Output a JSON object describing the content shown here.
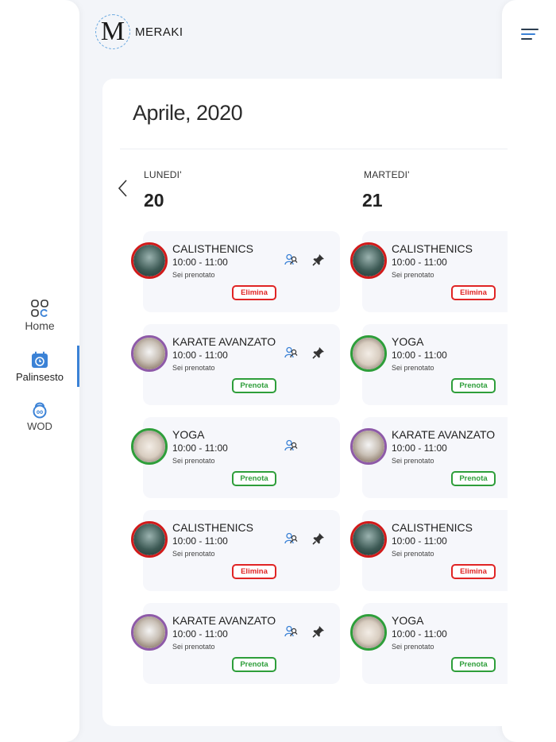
{
  "logo": {
    "mark": "M",
    "text": "MERAKI"
  },
  "sidebar": {
    "items": [
      {
        "label": "Home",
        "icon": "grid-icon"
      },
      {
        "label": "Palinsesto",
        "icon": "calendar-clock-icon",
        "active": true
      },
      {
        "label": "WOD",
        "icon": "kettlebell-icon"
      }
    ]
  },
  "calendar": {
    "month_title": "Aprile, 2020",
    "days": [
      {
        "name": "LUNEDI'",
        "number": "20",
        "events": [
          {
            "title": "CALISTHENICS",
            "time": "10:00 - 11:00",
            "status": "Sei prenotato",
            "button": "Elimina",
            "button_color": "red",
            "ring": "#d11a1a",
            "pinned": true
          },
          {
            "title": "KARATE AVANZATO",
            "time": "10:00 - 11:00",
            "status": "Sei prenotato",
            "button": "Prenota",
            "button_color": "green",
            "ring": "#8e5aa8",
            "pinned": true
          },
          {
            "title": "YOGA",
            "time": "10:00 - 11:00",
            "status": "Sei prenotato",
            "button": "Prenota",
            "button_color": "green",
            "ring": "#2e9e3a",
            "pinned": false
          },
          {
            "title": "CALISTHENICS",
            "time": "10:00 - 11:00",
            "status": "Sei prenotato",
            "button": "Elimina",
            "button_color": "red",
            "ring": "#d11a1a",
            "pinned": true
          },
          {
            "title": "KARATE AVANZATO",
            "time": "10:00 - 11:00",
            "status": "Sei prenotato",
            "button": "Prenota",
            "button_color": "green",
            "ring": "#8e5aa8",
            "pinned": true
          }
        ]
      },
      {
        "name": "MARTEDI'",
        "number": "21",
        "events": [
          {
            "title": "CALISTHENICS",
            "time": "10:00 - 11:00",
            "status": "Sei prenotato",
            "button": "Elimina",
            "button_color": "red",
            "ring": "#d11a1a"
          },
          {
            "title": "YOGA",
            "time": "10:00 - 11:00",
            "status": "Sei prenotato",
            "button": "Prenota",
            "button_color": "green",
            "ring": "#2e9e3a"
          },
          {
            "title": "KARATE AVANZATO",
            "time": "10:00 - 11:00",
            "status": "Sei prenotato",
            "button": "Prenota",
            "button_color": "green",
            "ring": "#8e5aa8"
          },
          {
            "title": "CALISTHENICS",
            "time": "10:00 - 11:00",
            "status": "Sei prenotato",
            "button": "Elimina",
            "button_color": "red",
            "ring": "#d11a1a"
          },
          {
            "title": "YOGA",
            "time": "10:00 - 11:00",
            "status": "Sei prenotato",
            "button": "Prenota",
            "button_color": "green",
            "ring": "#2e9e3a"
          }
        ]
      }
    ]
  },
  "colors": {
    "accent": "#3b82d6",
    "delete": "#e02424",
    "book": "#2e9e3a"
  }
}
